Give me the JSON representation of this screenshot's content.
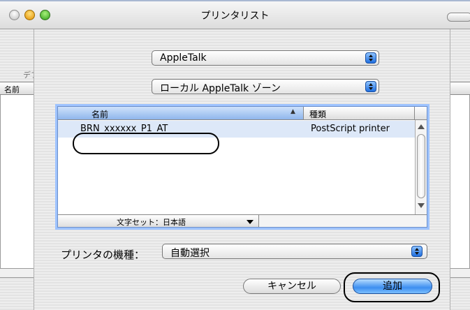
{
  "window": {
    "title": "プリンタリスト"
  },
  "background": {
    "partial_label": "デフ",
    "partial_header": "名前"
  },
  "sheet": {
    "protocol_popup": {
      "selected": "AppleTalk"
    },
    "zone_popup": {
      "selected": "ローカル AppleTalk ゾーン"
    },
    "list": {
      "columns": [
        "名前",
        "種類"
      ],
      "sort_indicator": "▲",
      "rows": [
        {
          "name": "BRN_xxxxxx_P1_AT",
          "kind": "PostScript printer",
          "selected": true
        }
      ],
      "charset_label": "文字セット：日本語"
    },
    "model": {
      "label": "プリンタの機種：",
      "selected": "自動選択"
    },
    "buttons": {
      "cancel": "キャンセル",
      "add": "追加"
    }
  },
  "colors": {
    "accent": "#3d8ef0",
    "selection": "#dde8f8",
    "focus_ring": "#9ec3ff"
  }
}
